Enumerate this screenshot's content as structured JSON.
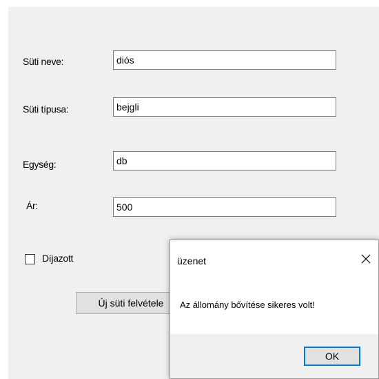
{
  "form": {
    "fields": [
      {
        "label": "Süti neve:",
        "value": "diós"
      },
      {
        "label": "Süti típusa:",
        "value": "bejgli"
      },
      {
        "label": "Egység:",
        "value": "db"
      },
      {
        "label": "Ár:",
        "value": "500"
      }
    ],
    "checkbox": {
      "label": "Díjazott",
      "checked": false
    },
    "add_button_label": "Új süti felvétele"
  },
  "dialog": {
    "title": "üzenet",
    "close_icon": "close-icon",
    "message": "Az állomány bővítése sikeres volt!",
    "ok_label": "OK"
  }
}
